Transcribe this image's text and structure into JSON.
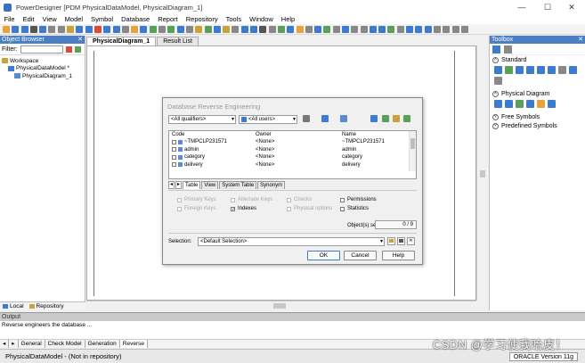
{
  "window": {
    "title": "PowerDesigner [PDM PhysicalDataModel, PhysicalDiagram_1]",
    "minimize": "—",
    "maximize": "☐",
    "close": "✕"
  },
  "menu": [
    "File",
    "Edit",
    "View",
    "Model",
    "Symbol",
    "Database",
    "Report",
    "Repository",
    "Tools",
    "Window",
    "Help"
  ],
  "toolbar_colors": [
    "#e8a33b",
    "#3d7bd0",
    "#3d7bd0",
    "#555",
    "#3d7bd0",
    "#888",
    "#888",
    "#c9a23c",
    "#3d7bd0",
    "#3d7bd0",
    "#d94b3b",
    "#3d7bd0",
    "#3d7bd0",
    "#888",
    "#e8a33b",
    "#3d7bd0",
    "#5aa05a",
    "#888",
    "#5aa05a",
    "#3d7bd0",
    "#888",
    "#c9a23c",
    "#5aa05a",
    "#3d7bd0",
    "#c9a23c",
    "#888",
    "#3d7bd0",
    "#3d7bd0",
    "#555",
    "#888",
    "#5aa05a",
    "#3d7bd0",
    "#e8a33b",
    "#888",
    "#3d7bd0",
    "#5aa05a",
    "#888",
    "#3d7bd0",
    "#888",
    "#888",
    "#3d7bd0",
    "#3d7bd0",
    "#5aa05a",
    "#888",
    "#3d7bd0",
    "#3d7bd0",
    "#3d7bd0",
    "#888",
    "#888",
    "#888",
    "#888"
  ],
  "browser": {
    "title": "Object Browser",
    "close": "✕",
    "filter_label": "Filter:",
    "tree": [
      {
        "label": "Workspace",
        "indent": 0,
        "color": "#c9a23c"
      },
      {
        "label": "PhysicalDataModel *",
        "indent": 1,
        "color": "#3d7bd0"
      },
      {
        "label": "PhysicalDiagram_1",
        "indent": 2,
        "color": "#5a8ad6"
      }
    ],
    "tabs": [
      "Local",
      "Repository"
    ]
  },
  "doc_tabs": [
    "PhysicalDiagram_1",
    "Result List"
  ],
  "toolbox": {
    "title": "Toolbox",
    "close": "✕",
    "sections": {
      "standard": "Standard",
      "physical": "Physical Diagram",
      "free": "Free Symbols",
      "predefined": "Predefined Symbols"
    },
    "standard_colors": [
      "#3d7bd0",
      "#5aa05a",
      "#3d7bd0",
      "#3d7bd0",
      "#3d7bd0",
      "#3d7bd0",
      "#888",
      "#3d7bd0",
      "#888"
    ],
    "physical_colors": [
      "#3d7bd0",
      "#3d7bd0",
      "#5aa05a",
      "#3d7bd0",
      "#e8a33b",
      "#3d7bd0"
    ]
  },
  "dialog": {
    "title": "Database Reverse Engineering",
    "qualifiers": "<All qualifiers>",
    "users": "<All users>",
    "columns": {
      "code": "Code",
      "owner": "Owner",
      "name": "Name"
    },
    "rows": [
      {
        "code": "~TMPCLP231571",
        "owner": "<None>",
        "name": "~TMPCLP231571"
      },
      {
        "code": "admin",
        "owner": "<None>",
        "name": "admin"
      },
      {
        "code": "category",
        "owner": "<None>",
        "name": "category"
      },
      {
        "code": "delivery",
        "owner": "<None>",
        "name": "delivery"
      }
    ],
    "tabs": [
      "Table",
      "View",
      "System Table",
      "Synonym"
    ],
    "options": {
      "primary_keys": "Primary Keys",
      "alternate_keys": "Alternate Keys",
      "checks": "Checks",
      "permissions": "Permissions",
      "foreign_keys": "Foreign Keys",
      "indexes": "Indexes",
      "physical_options": "Physical options",
      "statistics": "Statistics"
    },
    "objects_selected_label": "Object(s) selected:",
    "objects_selected_value": "0 / 9",
    "selection_label": "Selection:",
    "selection_value": "<Default Selection>",
    "buttons": {
      "ok": "OK",
      "cancel": "Cancel",
      "help": "Help"
    }
  },
  "output": {
    "title": "Output",
    "text": "Reverse engineers the database ...",
    "tabs": [
      "General",
      "Check Model",
      "Generation",
      "Reverse"
    ]
  },
  "status": {
    "left": "PhysicalDataModel - (Not in repository)",
    "right": "ORACLE Version 11g"
  },
  "watermark": "CSDN @学习使我哈皮！"
}
